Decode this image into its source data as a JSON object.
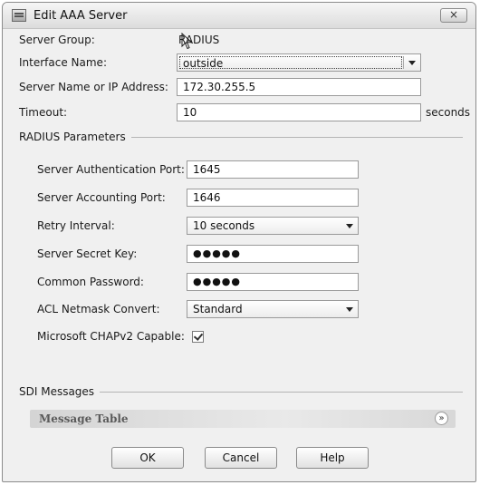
{
  "window": {
    "title": "Edit AAA Server",
    "close_glyph": "×"
  },
  "form": {
    "server_group_label": "Server Group:",
    "server_group_value": "RADIUS",
    "interface_label": "Interface Name:",
    "interface_value": "outside",
    "server_name_label": "Server Name or IP Address:",
    "server_name_value": "172.30.255.5",
    "timeout_label": "Timeout:",
    "timeout_value": "10",
    "timeout_unit": "seconds"
  },
  "radius": {
    "section_title": "RADIUS Parameters",
    "auth_port_label": "Server Authentication Port:",
    "auth_port_value": "1645",
    "acct_port_label": "Server Accounting Port:",
    "acct_port_value": "1646",
    "retry_label": "Retry Interval:",
    "retry_value": "10 seconds",
    "secret_label": "Server Secret Key:",
    "secret_value": "●●●●●",
    "common_pw_label": "Common Password:",
    "common_pw_value": "●●●●●",
    "acl_label": "ACL Netmask Convert:",
    "acl_value": "Standard",
    "chap_label": "Microsoft CHAPv2 Capable:",
    "chap_checked": true
  },
  "sdi": {
    "section_title": "SDI Messages",
    "message_table_title": "Message Table",
    "expand_glyph": "»"
  },
  "buttons": {
    "ok": "OK",
    "cancel": "Cancel",
    "help": "Help"
  },
  "icons": {
    "app": "aaa-server-icon",
    "close": "close-icon",
    "dropdown": "chevron-down-icon",
    "expand": "expand-icon",
    "pointer": "mouse-pointer-icon",
    "check": "checkmark-icon"
  }
}
